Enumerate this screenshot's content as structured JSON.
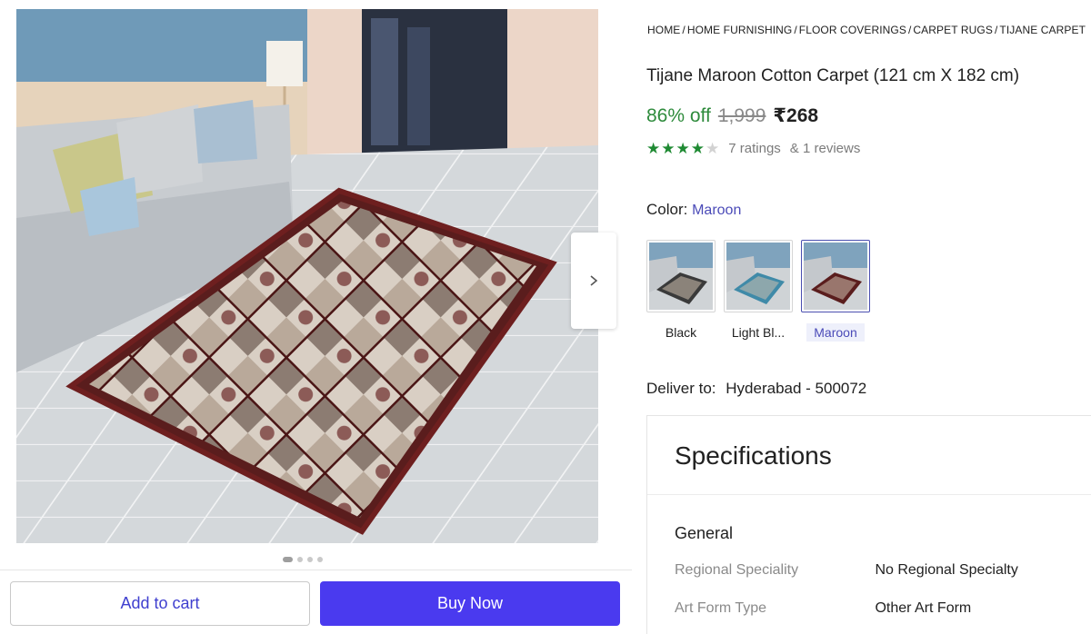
{
  "breadcrumb": [
    "HOME",
    "HOME FURNISHING",
    "FLOOR COVERINGS",
    "CARPET RUGS",
    "TIJANE CARPET"
  ],
  "breadcrumb_separator": "/",
  "product": {
    "title": "Tijane Maroon Cotton Carpet (121 cm  X 182 cm)",
    "discount": "86% off",
    "mrp": "1,999",
    "price": "₹268",
    "rating_stars": 4,
    "rating_max": 5,
    "ratings_text": "7 ratings",
    "reviews_text": "& 1 reviews"
  },
  "color": {
    "label": "Color:",
    "selected": "Maroon",
    "options": [
      {
        "name": "Black",
        "rug_color": "#3a3a3a",
        "selected": false
      },
      {
        "name": "Light Bl...",
        "rug_color": "#3f8aa8",
        "selected": false
      },
      {
        "name": "Maroon",
        "rug_color": "#5a1d1d",
        "selected": true
      }
    ]
  },
  "delivery": {
    "label": "Deliver to:",
    "location": "Hyderabad - 500072"
  },
  "specifications": {
    "heading": "Specifications",
    "group": "General",
    "rows": [
      {
        "key": "Regional Speciality",
        "value": "No Regional Specialty"
      },
      {
        "key": "Art Form Type",
        "value": "Other Art Form"
      }
    ]
  },
  "gallery": {
    "image_count": 4,
    "active_index": 0
  },
  "actions": {
    "add_to_cart": "Add to cart",
    "buy_now": "Buy Now"
  },
  "colors": {
    "accent": "#4a3aef",
    "discount_green": "#2e8b3c",
    "star_green": "#1f8a33",
    "link_blue": "#4b4bb8"
  }
}
